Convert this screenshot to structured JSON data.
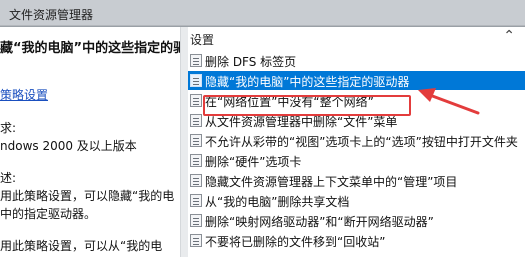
{
  "window": {
    "title": "文件资源管理器"
  },
  "left": {
    "heading": "藏“我的电脑”中的这些指定的驱动",
    "edit_link": "策略设置",
    "req_label": "求:",
    "req_value": "ndows 2000 及以上版本",
    "desc_label": "述:",
    "desc_lines": [
      "用此策略设置，可以隐藏“我的电",
      "中的指定驱动器。",
      "用此策略设置，可以从“我的电"
    ]
  },
  "right": {
    "column_header": "设置",
    "items": [
      "删除 DFS 标签页",
      "隐藏“我的电脑”中的这些指定的驱动器",
      "在“网络位置”中没有“整个网络”",
      "从文件资源管理器中删除“文件”菜单",
      "不允许从彩带的“视图”选项卡上的“选项”按钮中打开文件夹",
      "删除“硬件”选项卡",
      "隐藏文件资源管理器上下文菜单中的“管理”项目",
      "从“我的电脑”删除共享文档",
      "删除“映射网络驱动器”和“断开网络驱动器”",
      "不要将已删除的文件移到“回收站”"
    ],
    "selected_index": 1
  },
  "colors": {
    "selection": "#0078d7",
    "annotation": "#e33c3c"
  }
}
